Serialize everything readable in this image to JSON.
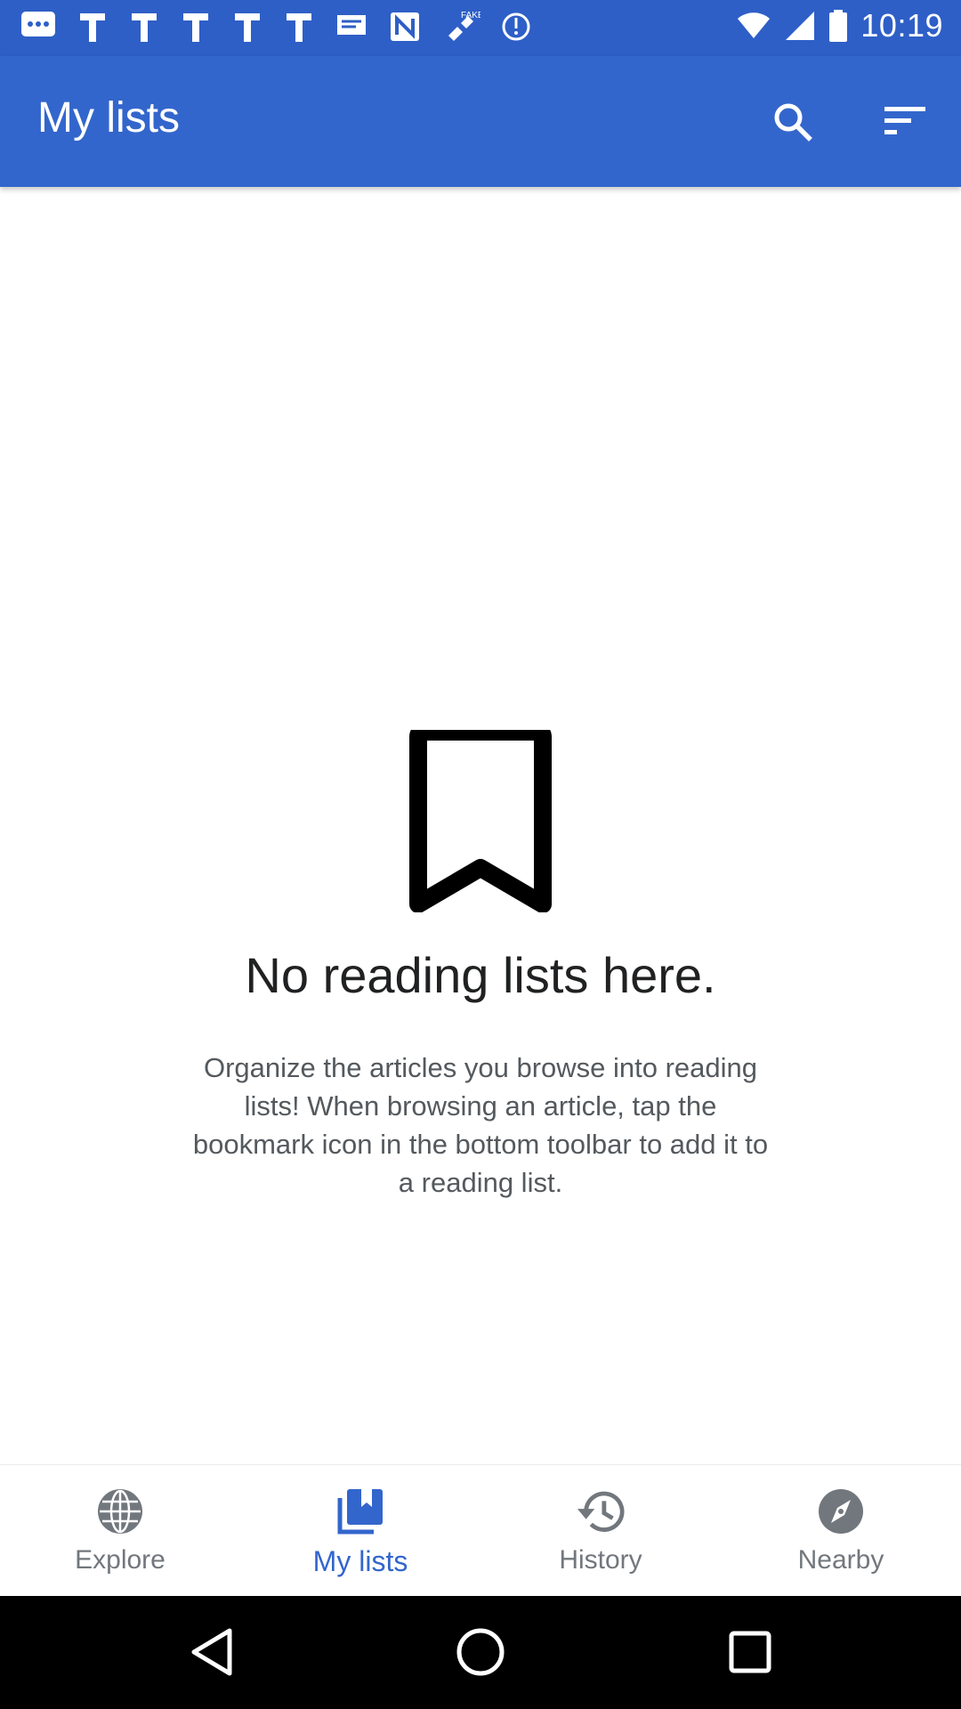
{
  "status_bar": {
    "time": "10:19",
    "notification_icons": [
      "chat-icon",
      "app-icon",
      "app-icon",
      "app-icon",
      "app-icon",
      "app-icon",
      "message-icon",
      "news-icon",
      "satellite-fake-icon",
      "sync-icon"
    ],
    "status_icons": [
      "wifi-icon",
      "signal-icon",
      "battery-icon"
    ]
  },
  "app_bar": {
    "title": "My lists",
    "search_icon": "search-icon",
    "sort_icon": "sort-icon",
    "color": "#3366cc"
  },
  "empty_state": {
    "icon": "bookmark-icon",
    "title": "No reading lists here.",
    "description": "Organize the articles you browse into reading lists! When browsing an article, tap the bookmark icon in the bottom toolbar to add it to a reading list."
  },
  "bottom_nav": {
    "items": [
      {
        "label": "Explore",
        "icon": "globe-icon",
        "active": false
      },
      {
        "label": "My lists",
        "icon": "my-lists-icon",
        "active": true
      },
      {
        "label": "History",
        "icon": "history-icon",
        "active": false
      },
      {
        "label": "Nearby",
        "icon": "compass-icon",
        "active": false
      }
    ],
    "active_color": "#3366cc",
    "inactive_color": "#72777d"
  },
  "system_nav": {
    "buttons": [
      "back-icon",
      "home-icon",
      "recents-icon"
    ]
  }
}
